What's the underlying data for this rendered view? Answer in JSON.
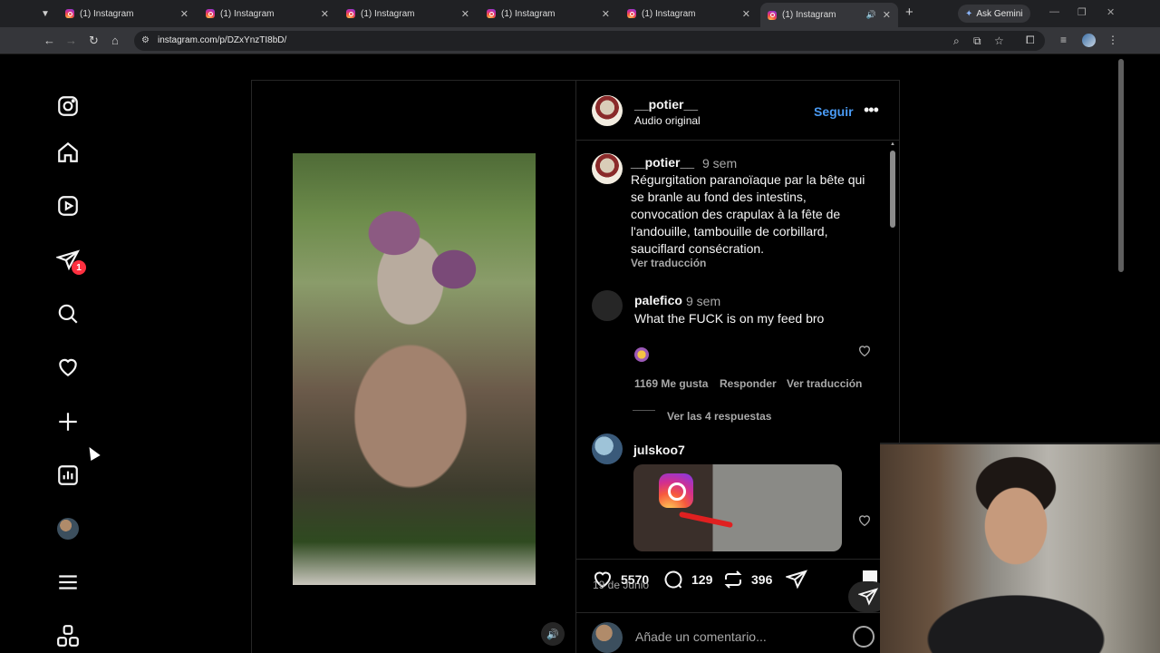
{
  "browser": {
    "tabs": [
      {
        "title": "(1) Instagram"
      },
      {
        "title": "(1) Instagram"
      },
      {
        "title": "(1) Instagram"
      },
      {
        "title": "(1) Instagram"
      },
      {
        "title": "(1) Instagram"
      },
      {
        "title": "(1) Instagram",
        "active": true
      }
    ],
    "gemini_label": "Ask Gemini",
    "url": "instagram.com/p/DZxYnzTI8bD/"
  },
  "sidebar": {
    "items": [
      {
        "icon": "instagram-logo-icon"
      },
      {
        "icon": "home-icon"
      },
      {
        "icon": "reels-icon"
      },
      {
        "icon": "messages-icon",
        "badge": "1"
      },
      {
        "icon": "search-icon"
      },
      {
        "icon": "notifications-heart-icon"
      },
      {
        "icon": "create-plus-icon"
      },
      {
        "icon": "dashboard-icon"
      },
      {
        "icon": "profile-avatar"
      },
      {
        "icon": "menu-icon"
      },
      {
        "icon": "also-from-meta-icon"
      }
    ]
  },
  "post": {
    "author": "__potier__",
    "audio": "Audio original",
    "follow_label": "Seguir",
    "caption": {
      "author": "__potier__",
      "time": "9 sem",
      "text": "Régurgitation paranoïaque par la bête qui se branle au fond des intestins, convocation des crapulax à la fête de l'andouille, tambouille de corbillard, sauciflard consécration.",
      "translate": "Ver traducción"
    },
    "comments": [
      {
        "user": "palefico",
        "time": "9 sem",
        "text": "What the FUCK is on my feed bro",
        "likes": "1169 Me gusta",
        "reply": "Responder",
        "translate": "Ver traducción",
        "view_replies": "Ver las 4 respuestas"
      },
      {
        "user": "julskoo7"
      }
    ],
    "likes": "5570",
    "comments_count": "129",
    "reposts": "396",
    "date": "19 de Junio",
    "add_comment_placeholder": "Añade un comentario..."
  },
  "colors": {
    "accent_blue": "#4a9bf5",
    "badge_red": "#ff3040",
    "muted_text": "#a8a8a8"
  }
}
